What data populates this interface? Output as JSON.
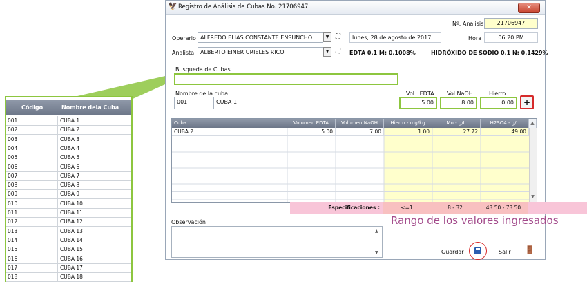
{
  "window": {
    "title": "Registro de Análisis de Cubas No. 21706947",
    "close_label": "✕"
  },
  "header": {
    "analisis_label": "Nº. Analisis",
    "analisis_value": "21706947",
    "operario_label": "Operario",
    "operario_value": "ALFREDO ELIAS CONSTANTE ENSUNCHO",
    "fecha_value": "lunes, 28 de agosto de 2017",
    "hora_label": "Hora",
    "hora_value": "06:20 PM",
    "analista_label": "Analista",
    "analista_value": "ALBERTO EINER URIELES RICO",
    "edta_text": "EDTA 0.1 M: 0.1008%",
    "naoh_text": "HIDRÓXIDO DE SODIO 0.1 N: 0.1429%"
  },
  "search": {
    "label": "Busqueda de Cubas ...",
    "value": ""
  },
  "entry": {
    "nombre_label": "Nombre de la cuba",
    "codigo_value": "001",
    "nombre_value": "CUBA 1",
    "vol_edta_label": "Vol . EDTA",
    "vol_edta_value": "5.00",
    "vol_naoh_label": "Vol NaOH",
    "vol_naoh_value": "8.00",
    "hierro_label": "Hierro",
    "hierro_value": "0.00",
    "add_icon": "plus-icon"
  },
  "grid": {
    "columns": [
      "Cuba",
      "Volumen EDTA",
      "Volumen NaOH",
      "Hierro - mg/kg",
      "Mn - g/L",
      "H2SO4 - g/L"
    ],
    "rows": [
      [
        "CUBA 2",
        "5.00",
        "7.00",
        "1.00",
        "27.72",
        "49.00"
      ]
    ]
  },
  "specs": {
    "label": "Especificaciones :",
    "hierro": "<=1",
    "mn": "8 - 32",
    "h2so4": "43.50 - 73.50"
  },
  "annotation": {
    "range_text": "Rango de los valores ingresados",
    "color": "#a2498a"
  },
  "observacion": {
    "label": "Observación",
    "value": ""
  },
  "actions": {
    "guardar_label": "Guardar",
    "salir_label": "Salir"
  },
  "side_panel": {
    "col_codigo": "Código",
    "col_nombre": "Nombre dela Cuba",
    "rows": [
      [
        "001",
        "CUBA 1"
      ],
      [
        "002",
        "CUBA 2"
      ],
      [
        "003",
        "CUBA 3"
      ],
      [
        "004",
        "CUBA 4"
      ],
      [
        "005",
        "CUBA 5"
      ],
      [
        "006",
        "CUBA 6"
      ],
      [
        "007",
        "CUBA 7"
      ],
      [
        "008",
        "CUBA 8"
      ],
      [
        "009",
        "CUBA 9"
      ],
      [
        "010",
        "CUBA 10"
      ],
      [
        "011",
        "CUBA 11"
      ],
      [
        "012",
        "CUBA 12"
      ],
      [
        "013",
        "CUBA 13"
      ],
      [
        "014",
        "CUBA 14"
      ],
      [
        "015",
        "CUBA 15"
      ],
      [
        "016",
        "CUBA 16"
      ],
      [
        "017",
        "CUBA 17"
      ],
      [
        "018",
        "CUBA 18"
      ]
    ]
  },
  "colors": {
    "accent_green": "#8dc63f",
    "spec_pink": "#f8c5d8",
    "highlight_red": "#d62b2b",
    "yellow_cell": "#ffffcc"
  }
}
